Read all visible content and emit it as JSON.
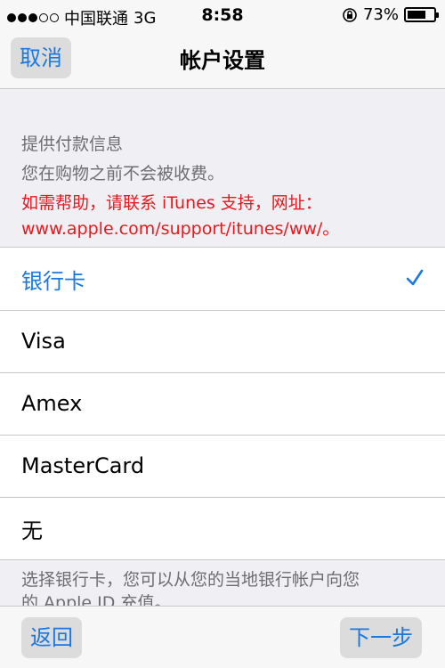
{
  "status_bar": {
    "carrier": "中国联通",
    "network": "3G",
    "time": "8:58",
    "battery": "73%",
    "battery_level": 0.73,
    "signal_icon": "signal-dots-icon",
    "rotation_lock_icon": "rotation-lock-icon",
    "battery_icon": "battery-icon"
  },
  "nav": {
    "cancel_label": "取消",
    "title": "帐户设置"
  },
  "info": {
    "heading": "提供付款信息",
    "line1": "您在购物之前不会被收费。",
    "help_line1": "如需帮助，请联系 iTunes 支持，网址：",
    "help_line2": "www.apple.com/support/itunes/ww/。"
  },
  "payment_options": [
    {
      "label": "银行卡",
      "selected": true
    },
    {
      "label": "Visa",
      "selected": false
    },
    {
      "label": "Amex",
      "selected": false
    },
    {
      "label": "MasterCard",
      "selected": false
    },
    {
      "label": "无",
      "selected": false
    }
  ],
  "footer": {
    "line1": "选择银行卡，您可以从您的当地银行帐户向您",
    "line2": "的 Apple ID 充值。"
  },
  "toolbar": {
    "back_label": "返回",
    "next_label": "下一步"
  },
  "colors": {
    "accent": "#1a78e0",
    "help_text": "#e8191e",
    "background": "#efeff4"
  }
}
